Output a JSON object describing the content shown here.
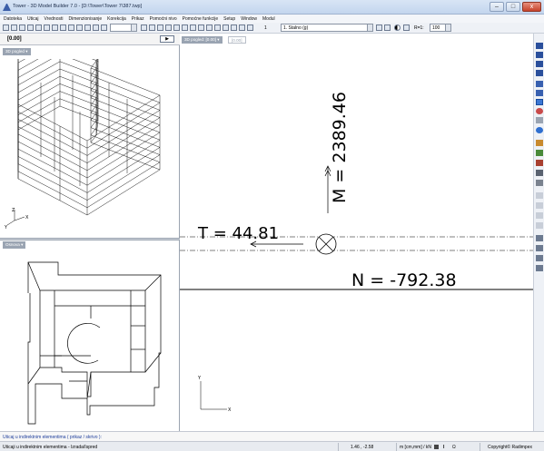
{
  "window": {
    "title": "Tower - 3D Model Builder 7.0 - [D:\\Tower\\Tower 7\\387.twp]",
    "minimize_glyph": "–",
    "maximize_glyph": "□",
    "close_glyph": "x"
  },
  "menu": [
    "Datoteka",
    "Uticaj",
    "Vrednosti",
    "Dimenzionisanje",
    "Korekcija",
    "Prikaz",
    "Pomoćni nivo",
    "Pomoćne funkcije",
    "Setup",
    "Window",
    "Modul"
  ],
  "toolbar": {
    "step_value": "1",
    "load_case": "1. Stalno (g)",
    "ratio_label": "R=1:",
    "ratio_value": "100"
  },
  "left_panel": {
    "value_display": "[0.00]",
    "view_3d_tag": "3D pogled",
    "osnova_tag": "Osnova",
    "play_glyph": "▶"
  },
  "main_view": {
    "view_tag": "3D pogled: [0.00]",
    "view_tag2": "[0.00]",
    "moment_label": "M = 2389.46",
    "shear_label": "T = 44.81",
    "normal_label": "N = -792.38",
    "axis_y": "Y",
    "axis_x": "X"
  },
  "axes_3d": {
    "x": "X",
    "y": "Y",
    "z": "Z"
  },
  "status": {
    "line1": "Uticaj u indirektnim elementima ( prikaz / skrivo ):",
    "line2": "Uticaji u indirektnim elementima - Izrada/Ispred",
    "coords": "1.46 , -2.58",
    "units": "m [cm,mm] / kN",
    "copyright": "Copyright© Radimpex"
  },
  "colors": {
    "titlebar": "#c3d5ee",
    "accent": "#1d3d9a",
    "drawing": "#000000"
  }
}
